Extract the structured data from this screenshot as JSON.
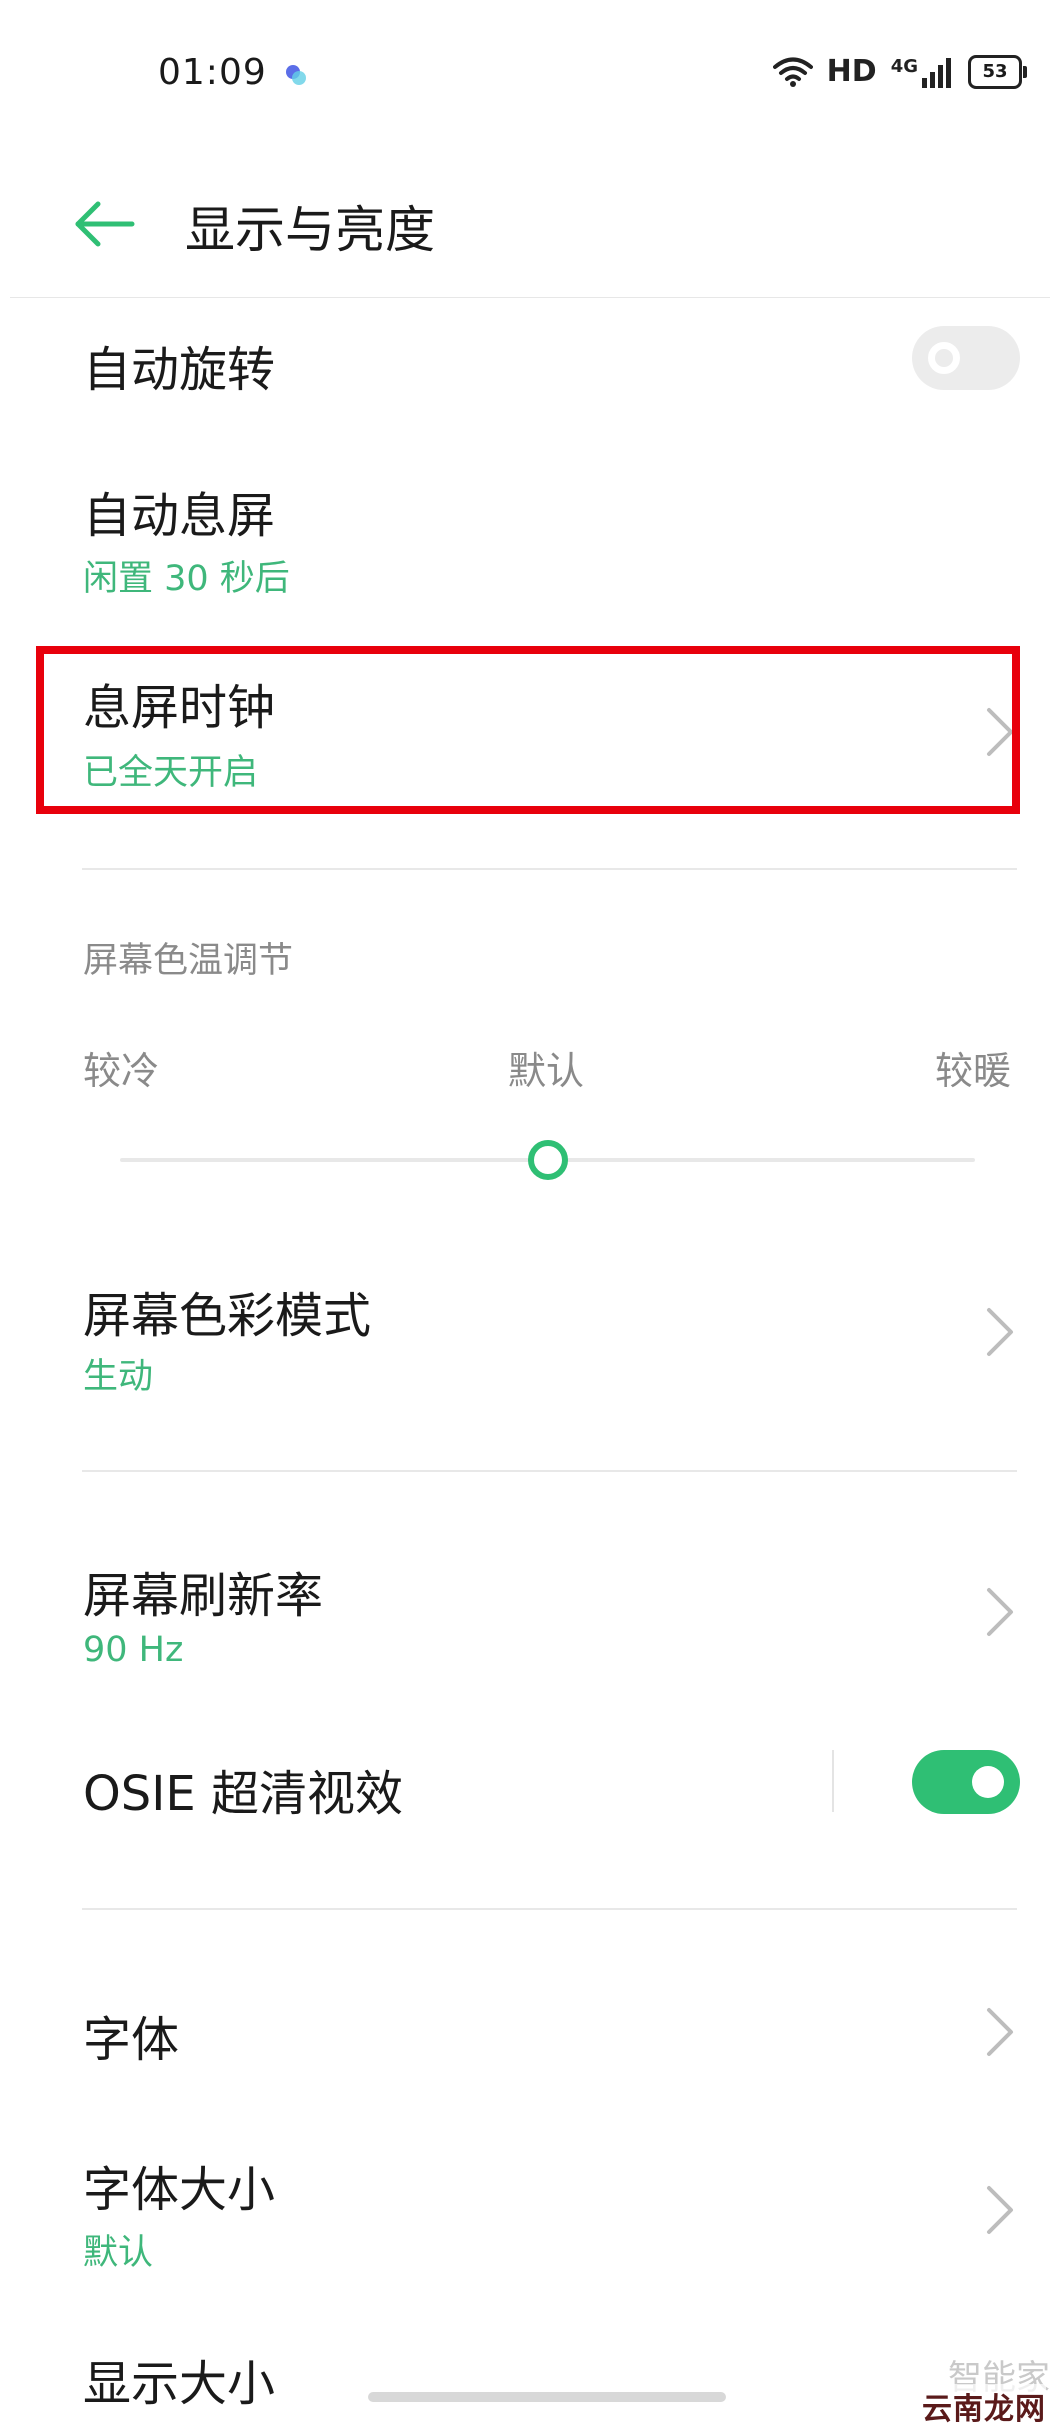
{
  "status_bar": {
    "time": "01:09",
    "hd": "HD",
    "network": "4G",
    "battery": "53"
  },
  "header": {
    "title": "显示与亮度"
  },
  "items": {
    "auto_rotate": {
      "title": "自动旋转",
      "toggle_on": false
    },
    "auto_screen_off": {
      "title": "自动息屏",
      "subtitle": "闲置 30 秒后"
    },
    "aod_clock": {
      "title": "息屏时钟",
      "subtitle": "已全天开启"
    },
    "color_temp": {
      "section_title": "屏幕色温调节",
      "cold": "较冷",
      "default": "默认",
      "warm": "较暖",
      "level": 0.5
    },
    "color_mode": {
      "title": "屏幕色彩模式",
      "subtitle": "生动"
    },
    "refresh_rate": {
      "title": "屏幕刷新率",
      "subtitle": "90 Hz"
    },
    "osie": {
      "title": "OSIE 超清视效",
      "toggle_on": true
    },
    "font": {
      "title": "字体"
    },
    "font_size": {
      "title": "字体大小",
      "subtitle": "默认"
    },
    "display_size": {
      "title": "显示大小"
    }
  },
  "watermark": {
    "line1": "智能家",
    "line2": "云南龙网"
  },
  "colors": {
    "accent": "#2fbf74",
    "subtitle": "#3fb77b",
    "highlight": "#e8000c"
  }
}
